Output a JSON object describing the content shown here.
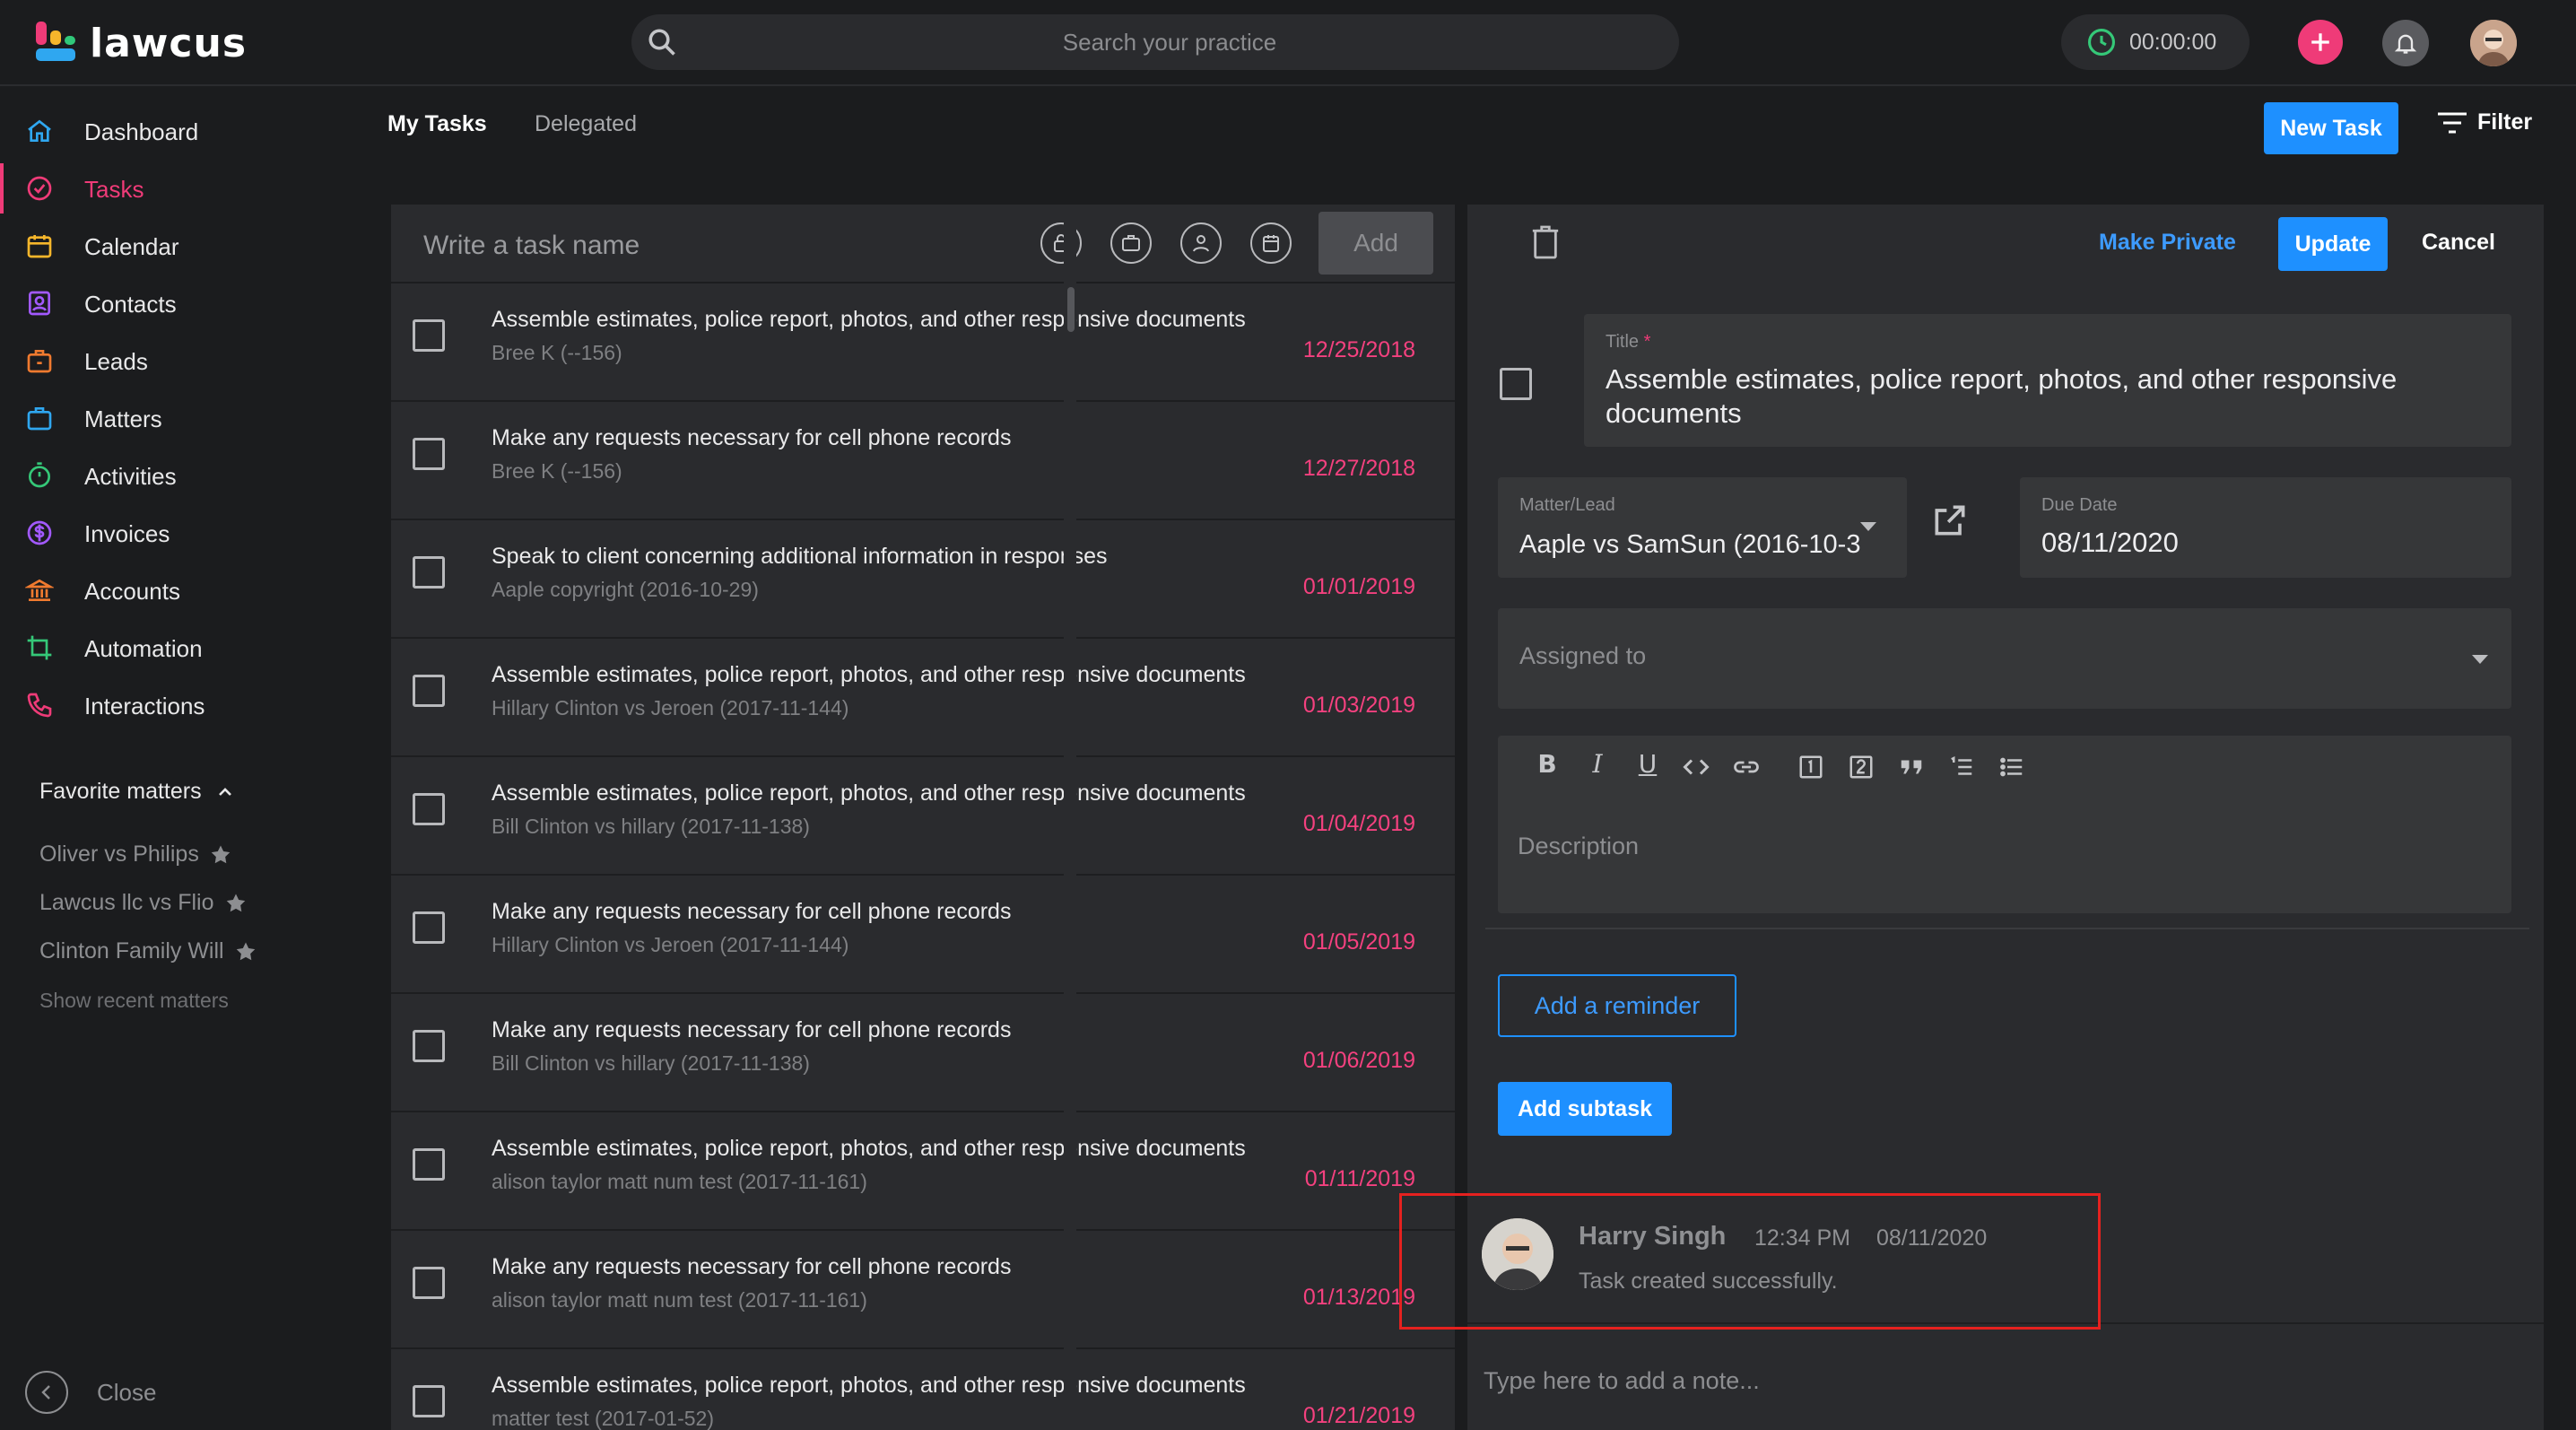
{
  "app": {
    "logo_text": "lawcus",
    "brand_color": "#ef3b78",
    "accent_color": "#1e90ff"
  },
  "header": {
    "search_placeholder": "Search your practice",
    "timer": "00:00:00"
  },
  "sidebar": {
    "items": [
      {
        "label": "Dashboard",
        "icon": "home-icon"
      },
      {
        "label": "Tasks",
        "icon": "check-circle-icon"
      },
      {
        "label": "Calendar",
        "icon": "calendar-icon"
      },
      {
        "label": "Contacts",
        "icon": "contacts-icon"
      },
      {
        "label": "Leads",
        "icon": "leads-icon"
      },
      {
        "label": "Matters",
        "icon": "briefcase-icon"
      },
      {
        "label": "Activities",
        "icon": "stopwatch-icon"
      },
      {
        "label": "Invoices",
        "icon": "dollar-icon"
      },
      {
        "label": "Accounts",
        "icon": "bank-icon"
      },
      {
        "label": "Automation",
        "icon": "crop-icon"
      },
      {
        "label": "Interactions",
        "icon": "phone-icon"
      }
    ],
    "favorites_title": "Favorite matters",
    "favorites": [
      "Oliver vs Philips",
      "Lawcus llc vs Flio",
      "Clinton Family Will"
    ],
    "show_recent": "Show recent matters",
    "close_label": "Close"
  },
  "tabs": {
    "my_tasks": "My Tasks",
    "delegated": "Delegated"
  },
  "actions": {
    "new_task": "New Task",
    "filter": "Filter"
  },
  "task_list": {
    "input_placeholder": "Write a task name",
    "add_label": "Add",
    "tasks": [
      {
        "title": "Assemble estimates, police report, photos, and other responsive documents",
        "matter": "Bree K (--156)",
        "date": "12/25/2018"
      },
      {
        "title": "Make any requests necessary for cell phone records",
        "matter": "Bree K (--156)",
        "date": "12/27/2018"
      },
      {
        "title": "Speak to client concerning additional information in responses",
        "matter": "Aaple copyright (2016-10-29)",
        "date": "01/01/2019"
      },
      {
        "title": "Assemble estimates, police report, photos, and other responsive documents",
        "matter": "Hillary Clinton vs Jeroen (2017-11-144)",
        "date": "01/03/2019"
      },
      {
        "title": "Assemble estimates, police report, photos, and other responsive documents",
        "matter": "Bill Clinton vs hillary (2017-11-138)",
        "date": "01/04/2019"
      },
      {
        "title": "Make any requests necessary for cell phone records",
        "matter": "Hillary Clinton vs Jeroen (2017-11-144)",
        "date": "01/05/2019"
      },
      {
        "title": "Make any requests necessary for cell phone records",
        "matter": "Bill Clinton vs hillary (2017-11-138)",
        "date": "01/06/2019"
      },
      {
        "title": "Assemble estimates, police report, photos, and other responsive documents",
        "matter": "alison taylor matt num test (2017-11-161)",
        "date": "01/11/2019"
      },
      {
        "title": "Make any requests necessary for cell phone records",
        "matter": "alison taylor matt num test (2017-11-161)",
        "date": "01/13/2019"
      },
      {
        "title": "Assemble estimates, police report, photos, and other responsive documents",
        "matter": "matter test (2017-01-52)",
        "date": "01/21/2019"
      }
    ]
  },
  "detail": {
    "make_private": "Make Private",
    "update": "Update",
    "cancel": "Cancel",
    "title_label": "Title",
    "title_required": "*",
    "title_value": "Assemble estimates, police report, photos, and other responsive documents",
    "matter_label": "Matter/Lead",
    "matter_value": "Aaple vs SamSun (2016-10-3",
    "due_label": "Due Date",
    "due_value": "08/11/2020",
    "assigned_placeholder": "Assigned to",
    "description_placeholder": "Description",
    "add_reminder": "Add a reminder",
    "add_subtask": "Add subtask",
    "activity": {
      "name": "Harry Singh",
      "time": "12:34 PM",
      "date": "08/11/2020",
      "message": "Task created successfully."
    },
    "note_placeholder": "Type here to add a note..."
  }
}
